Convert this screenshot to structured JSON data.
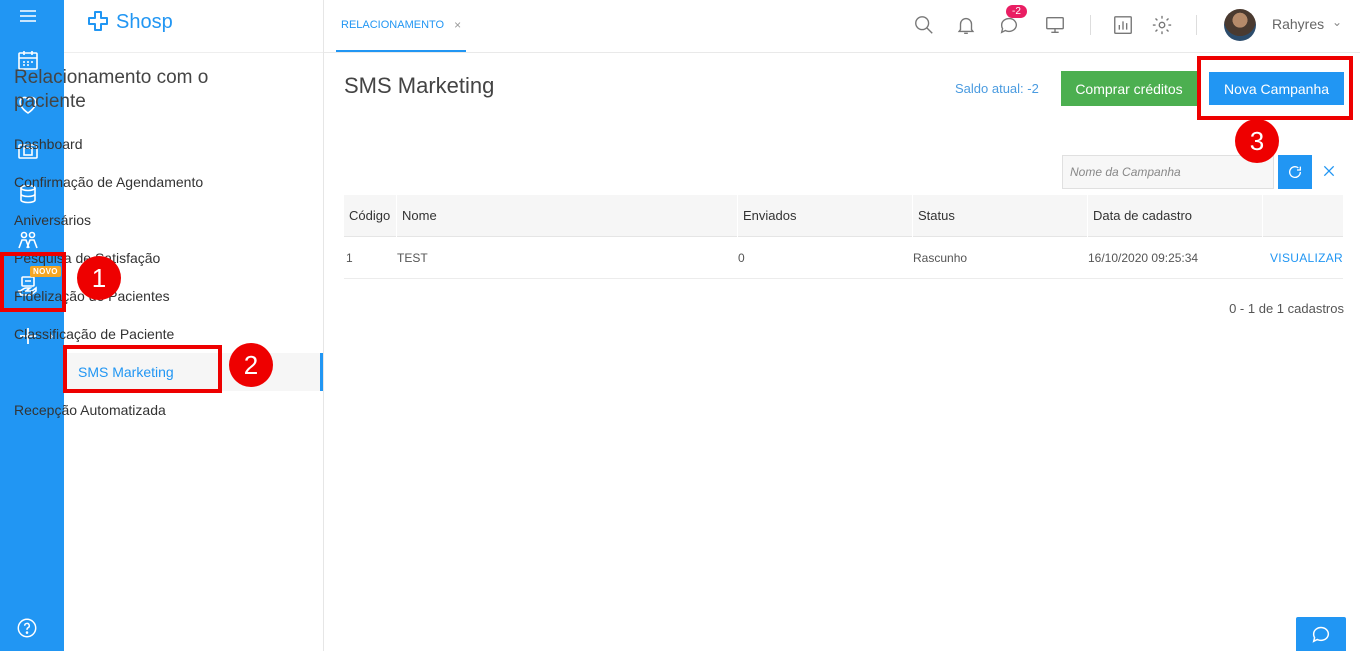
{
  "app": {
    "logo_text": "Shosp"
  },
  "rail": {
    "novo_badge": "NOVO",
    "icons": [
      "menu-icon",
      "calendar-icon",
      "heart-icon",
      "money-icon",
      "database-icon",
      "people-icon",
      "relationship-icon",
      "plus-icon",
      "help-icon"
    ]
  },
  "header": {
    "tab_label": "RELACIONAMENTO",
    "tab_close": "×",
    "message_badge": "-2",
    "username": "Rahyres"
  },
  "sidebar": {
    "title": "Relacionamento com o paciente",
    "items": [
      {
        "label": "Dashboard"
      },
      {
        "label": "Confirmação de Agendamento"
      },
      {
        "label": "Aniversários"
      },
      {
        "label": "Pesquisa de Satisfação"
      },
      {
        "label": "Fidelização de Pacientes"
      },
      {
        "label": "Classificação de Paciente"
      },
      {
        "label": "SMS Marketing"
      },
      {
        "label": "Recepção Automatizada"
      }
    ]
  },
  "main": {
    "title": "SMS Marketing",
    "saldo": "Saldo atual: -2",
    "buy_credits_label": "Comprar créditos",
    "new_campaign_label": "Nova Campanha",
    "search_placeholder": "Nome da Campanha",
    "table": {
      "columns": [
        "Código",
        "Nome",
        "Enviados",
        "Status",
        "Data de cadastro"
      ],
      "rows": [
        {
          "codigo": "1",
          "nome": "TEST",
          "enviados": "0",
          "status": "Rascunho",
          "data": "16/10/2020 09:25:34",
          "action": "VISUALIZAR"
        }
      ]
    },
    "pager": "0 - 1 de 1 cadastros"
  },
  "annotations": [
    "1",
    "2",
    "3"
  ],
  "colors": {
    "primary": "#2196f3",
    "success": "#4caf50",
    "annotation": "#e00000",
    "badge": "#e91e63"
  }
}
